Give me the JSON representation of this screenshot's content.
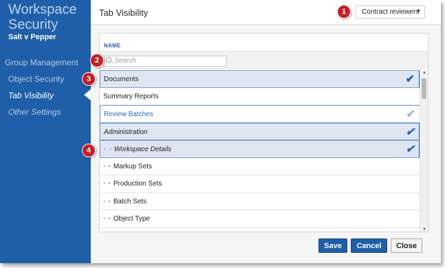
{
  "sidebar": {
    "workspace_title": "Workspace Security",
    "workspace_name": "Salt v Pepper",
    "nav": {
      "group_management": "Group Management",
      "object_security": "Object Security",
      "tab_visibility": "Tab Visibility",
      "other_settings": "Other Settings"
    }
  },
  "header": {
    "title": "Tab Visibility",
    "group_select": "Contract reviewers"
  },
  "grid": {
    "column_name": "NAME",
    "search_placeholder": "Search",
    "rows": [
      {
        "label": "Documents",
        "checked": true
      },
      {
        "label": "Summary Reports",
        "checked": false
      },
      {
        "label": "Review Batches",
        "checked": true
      },
      {
        "label": "Administration",
        "checked": true
      },
      {
        "label": "Workspace Details",
        "checked": true
      },
      {
        "label": "Markup Sets",
        "checked": false
      },
      {
        "label": "Production Sets",
        "checked": false
      },
      {
        "label": "Batch Sets",
        "checked": false
      },
      {
        "label": "Object Type",
        "checked": false
      }
    ],
    "child_marker": "• •",
    "check_glyph": "✔"
  },
  "buttons": {
    "save": "Save",
    "cancel": "Cancel",
    "close": "Close"
  },
  "callouts": [
    "1",
    "2",
    "3",
    "4"
  ],
  "colors": {
    "sidebar": "#1f5ea8",
    "callout": "#c0202a",
    "selected_row": "#dfe6f1"
  }
}
